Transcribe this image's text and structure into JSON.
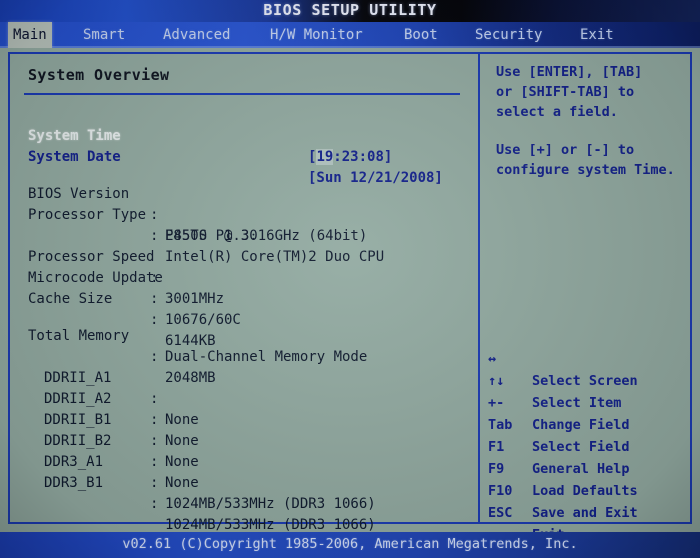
{
  "titlebar": {
    "title": "BIOS SETUP UTILITY"
  },
  "menubar": {
    "tabs": [
      {
        "label": "Main",
        "active": true
      },
      {
        "label": "Smart",
        "active": false
      },
      {
        "label": "Advanced",
        "active": false
      },
      {
        "label": "H/W Monitor",
        "active": false
      },
      {
        "label": "Boot",
        "active": false
      },
      {
        "label": "Security",
        "active": false
      },
      {
        "label": "Exit",
        "active": false
      }
    ]
  },
  "main": {
    "section_title": "System Overview",
    "settable_fields": [
      {
        "label": "System Time",
        "value_prefix": "[",
        "value_cursor": "19",
        "value_rest": ":23:08]",
        "full_value": "[19:23:08]",
        "selected": true
      },
      {
        "label": "System Date",
        "value_prefix": "[",
        "value_cursor": "",
        "value_rest": "Sun 12/21/2008]",
        "full_value": "[Sun 12/21/2008]",
        "selected": false
      }
    ],
    "info_rows": [
      {
        "label": "BIOS Version",
        "colon": ":",
        "value": "P45TS P1.30",
        "indent": false
      },
      {
        "label": "Processor Type",
        "colon": ":",
        "value": "Intel(R) Core(TM)2 Duo CPU",
        "indent": false
      },
      {
        "label": "",
        "colon": "",
        "value": "E8500  @ 3.16GHz (64bit)",
        "indent": false
      },
      {
        "label": "Processor Speed",
        "colon": ":",
        "value": "3001MHz",
        "indent": false
      },
      {
        "label": "Microcode Update",
        "colon": ":",
        "value": "10676/60C",
        "indent": false
      },
      {
        "label": "Cache Size",
        "colon": ":",
        "value": "6144KB",
        "indent": false
      }
    ],
    "memory_rows": [
      {
        "label": "Total Memory",
        "colon": ":",
        "value": "2048MB",
        "indent": false
      },
      {
        "label": "",
        "colon": "",
        "value": "Dual-Channel Memory Mode",
        "indent": false
      },
      {
        "label": "DDRII_A1",
        "colon": ":",
        "value": "None",
        "indent": true
      },
      {
        "label": "DDRII_A2",
        "colon": ":",
        "value": "None",
        "indent": true
      },
      {
        "label": "DDRII_B1",
        "colon": ":",
        "value": "None",
        "indent": true
      },
      {
        "label": "DDRII_B2",
        "colon": ":",
        "value": "None",
        "indent": true
      },
      {
        "label": "DDR3_A1",
        "colon": ":",
        "value": "1024MB/533MHz (DDR3 1066)",
        "indent": true
      },
      {
        "label": "DDR3_B1",
        "colon": ":",
        "value": "1024MB/533MHz (DDR3 1066)",
        "indent": true
      }
    ]
  },
  "help": {
    "paragraphs": [
      [
        "Use [ENTER], [TAB]",
        "or [SHIFT-TAB] to",
        "select a field."
      ],
      [
        "Use [+] or [-] to",
        "configure system Time."
      ]
    ],
    "keys": [
      {
        "key": "↔",
        "desc": "Select Screen",
        "name": "left-right-arrow-icon"
      },
      {
        "key": "↑↓",
        "desc": "Select Item",
        "name": "up-down-arrow-icon"
      },
      {
        "key": "+-",
        "desc": "Change Field",
        "name": "plus-minus-key"
      },
      {
        "key": "Tab",
        "desc": "Select Field",
        "name": "tab-key"
      },
      {
        "key": "F1",
        "desc": "General Help",
        "name": "f1-key"
      },
      {
        "key": "F9",
        "desc": "Load Defaults",
        "name": "f9-key"
      },
      {
        "key": "F10",
        "desc": "Save and Exit",
        "name": "f10-key"
      },
      {
        "key": "ESC",
        "desc": "Exit",
        "name": "esc-key"
      }
    ]
  },
  "footer": {
    "text": "v02.61 (C)Copyright 1985-2006, American Megatrends, Inc."
  },
  "colors": {
    "screen_bg": "#93aba2",
    "accent_blue": "#1b3bb5",
    "menu_blue": "#2450cf",
    "text_dark": "#0f1a2e",
    "text_blue": "#13218c",
    "tab_active_bg": "#b9c4bd",
    "title_text": "#eef2ff"
  }
}
